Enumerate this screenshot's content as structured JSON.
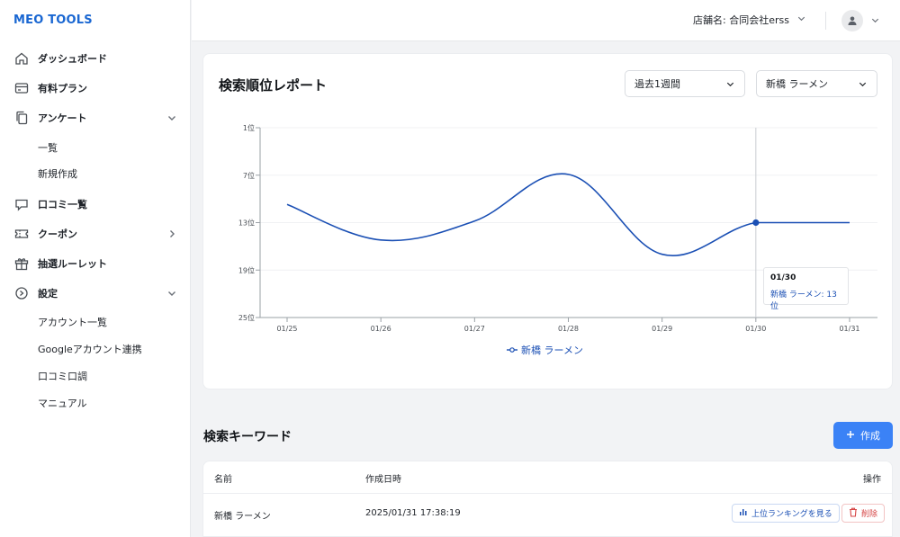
{
  "app": {
    "logo": "MEO TOOLS"
  },
  "sidebar": {
    "items": [
      {
        "label": "ダッシュボード",
        "icon": "home-icon"
      },
      {
        "label": "有料プラン",
        "icon": "credit-card-icon"
      },
      {
        "label": "アンケート",
        "icon": "copy-icon",
        "expanded": true
      },
      {
        "label": "口コミ一覧",
        "icon": "chat-icon"
      },
      {
        "label": "クーポン",
        "icon": "ticket-icon",
        "expanded": false
      },
      {
        "label": "抽選ルーレット",
        "icon": "gift-icon"
      },
      {
        "label": "設定",
        "icon": "gear-icon",
        "expanded": true
      }
    ],
    "survey_sub": [
      "一覧",
      "新規作成"
    ],
    "settings_sub": [
      "アカウント一覧",
      "Googleアカウント連携",
      "口コミ口調",
      "マニュアル"
    ]
  },
  "header": {
    "store_label": "店舗名: 合同会社erss"
  },
  "report": {
    "title": "検索順位レポート",
    "period_select": "過去1週間",
    "keyword_select": "新橋 ラーメン",
    "tooltip": {
      "date": "01/30",
      "value": "新橋 ラーメン: 13位"
    }
  },
  "chart_data": {
    "type": "line",
    "categories": [
      "01/25",
      "01/26",
      "01/27",
      "01/28",
      "01/29",
      "01/30",
      "01/31"
    ],
    "series": [
      {
        "name": "新橋 ラーメン",
        "values": [
          10.7,
          15.2,
          12.8,
          6.9,
          17.0,
          13,
          13
        ]
      }
    ],
    "y_ticks": [
      "1位",
      "7位",
      "13位",
      "19位",
      "25位"
    ],
    "y_tick_values": [
      1,
      7,
      13,
      19,
      25
    ],
    "ylim": [
      1,
      25
    ],
    "y_reversed": true,
    "color": "#1a4fb4",
    "highlight_category": "01/30",
    "grid": true,
    "legend": "bottom-center"
  },
  "keywords": {
    "title": "検索キーワード",
    "create_label": "作成",
    "headers": {
      "name": "名前",
      "created": "作成日時",
      "actions": "操作"
    },
    "rows": [
      {
        "name": "新橋 ラーメン",
        "created": "2025/01/31 17:38:19",
        "rank_btn": "上位ランキングを見る",
        "delete_btn": "削除"
      }
    ]
  }
}
